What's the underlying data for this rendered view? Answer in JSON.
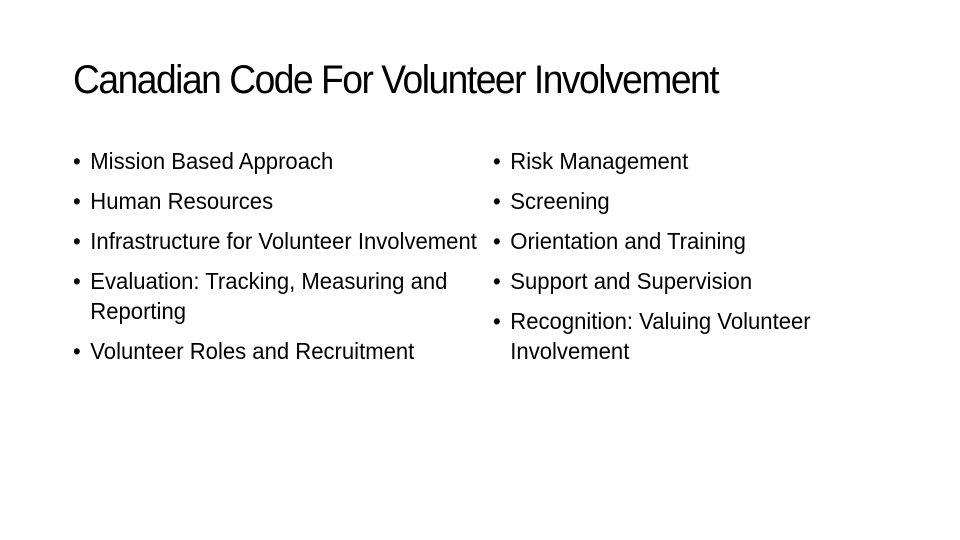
{
  "slide": {
    "title": "Canadian Code For Volunteer Involvement",
    "bullet_glyph": "•",
    "left_column": [
      "Mission Based Approach",
      "Human Resources",
      "Infrastructure for Volunteer Involvement",
      "Evaluation: Tracking, Measuring and Reporting",
      "Volunteer Roles and Recruitment"
    ],
    "right_column": [
      "Risk Management",
      "Screening",
      "Orientation and Training",
      "Support and Supervision",
      "Recognition: Valuing Volunteer Involvement"
    ]
  }
}
